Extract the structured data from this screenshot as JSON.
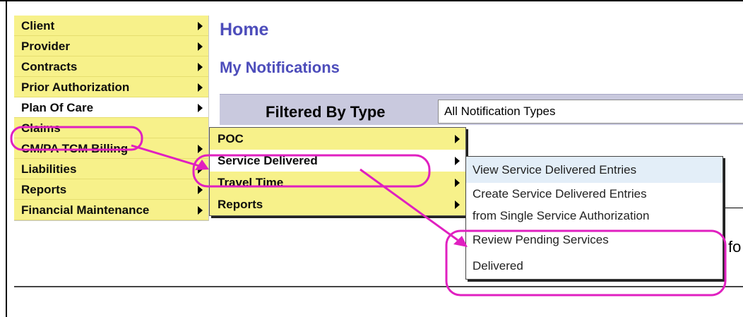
{
  "left_menu": {
    "items": [
      {
        "label": "Client"
      },
      {
        "label": "Provider"
      },
      {
        "label": "Contracts"
      },
      {
        "label": "Prior Authorization"
      },
      {
        "label": "Plan Of Care"
      },
      {
        "label": "Claims"
      },
      {
        "label": "CM/PA TCM Billing"
      },
      {
        "label": "Liabilities"
      },
      {
        "label": "Reports"
      },
      {
        "label": "Financial Maintenance"
      }
    ]
  },
  "header": {
    "title": "Home",
    "subtitle": "My Notifications"
  },
  "filter": {
    "label": "Filtered By Type",
    "selected": "All Notification Types"
  },
  "plan_of_care_menu": {
    "items": [
      {
        "label": "POC"
      },
      {
        "label": "Service Delivered"
      },
      {
        "label": "Travel Time"
      },
      {
        "label": "Reports"
      }
    ]
  },
  "service_delivered_menu": {
    "items": [
      {
        "label": "View Service Delivered Entries"
      },
      {
        "label": "Create Service Delivered Entries"
      },
      {
        "label": "from Single Service Authorization"
      },
      {
        "label": "Review Pending Services"
      },
      {
        "label": "Delivered"
      }
    ]
  },
  "background_text": "fo",
  "annotation_color": "#e020c0"
}
